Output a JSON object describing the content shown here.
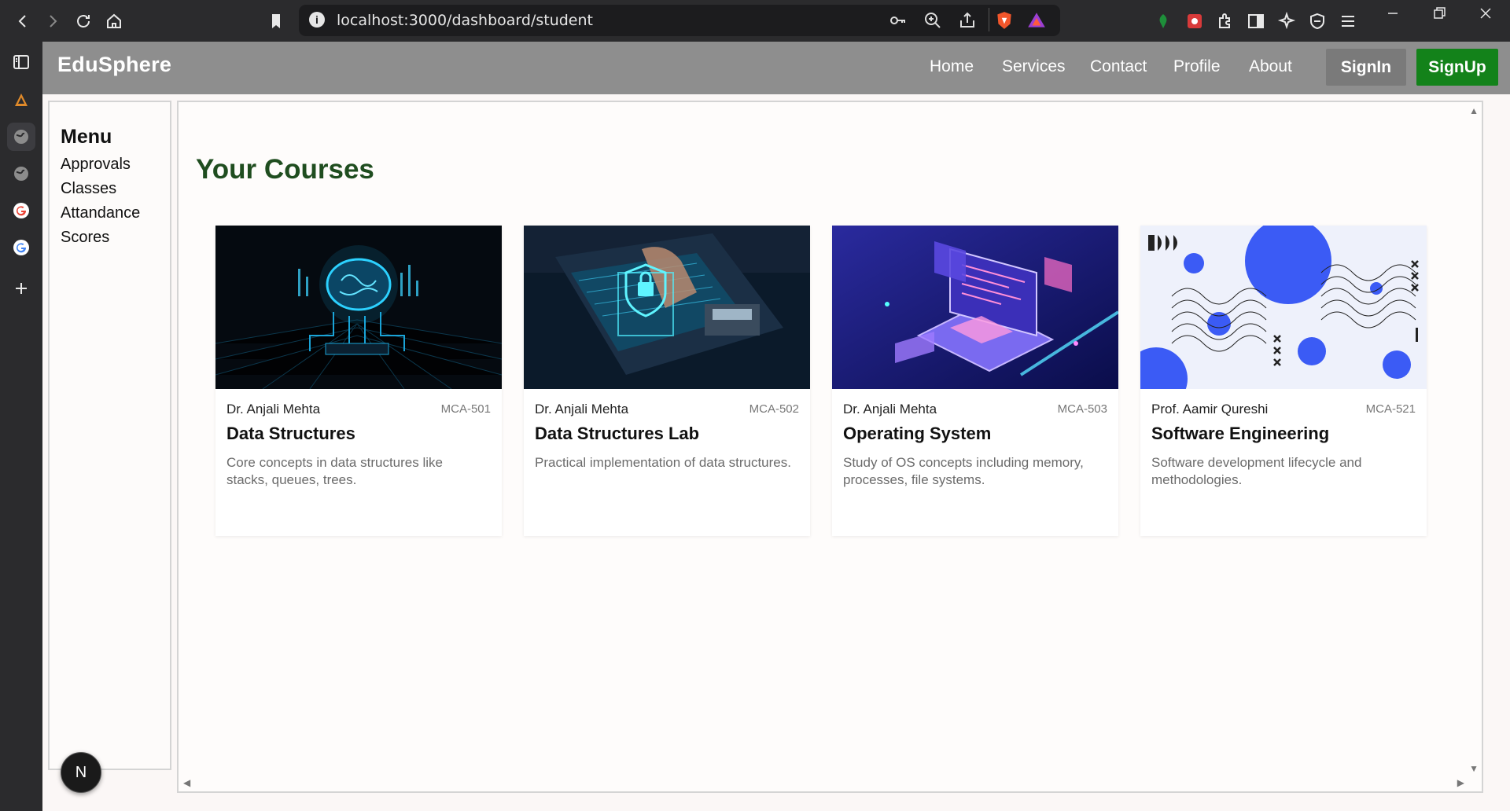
{
  "browser": {
    "url": "localhost:3000/dashboard/student"
  },
  "navbar": {
    "brand": "EduSphere",
    "links": [
      "Home",
      "Services",
      "Contact",
      "Profile",
      "About"
    ],
    "signin_label": "SignIn",
    "signup_label": "SignUp",
    "signup_color": "#13821a"
  },
  "menu": {
    "title": "Menu",
    "items": [
      "Approvals",
      "Classes",
      "Attandance",
      "Scores"
    ]
  },
  "main": {
    "title": "Your Courses",
    "title_color": "#1f4d1f",
    "courses": [
      {
        "teacher": "Dr. Anjali Mehta",
        "code": "MCA-501",
        "name": "Data Structures",
        "description": "Core concepts in data structures like stacks, queues, trees.",
        "image": "glowing-brain-circuit-image"
      },
      {
        "teacher": "Dr. Anjali Mehta",
        "code": "MCA-502",
        "name": "Data Structures Lab",
        "description": "Practical implementation of data structures.",
        "image": "laptop-security-lock-image"
      },
      {
        "teacher": "Dr. Anjali Mehta",
        "code": "MCA-503",
        "name": "Operating System",
        "description": "Study of OS concepts including memory, processes, file systems.",
        "image": "isometric-laptop-screens-image"
      },
      {
        "teacher": "Prof. Aamir Qureshi",
        "code": "MCA-521",
        "name": "Software Engineering",
        "description": "Software development lifecycle and methodologies.",
        "image": "abstract-blue-circles-pattern-image"
      }
    ]
  },
  "dev_badge": "N"
}
